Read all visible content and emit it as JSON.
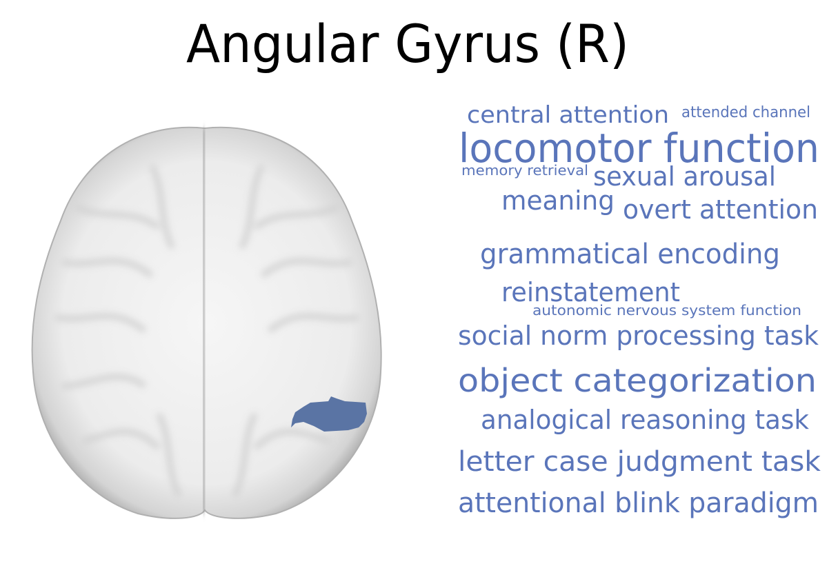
{
  "title": "Angular Gyrus (R)",
  "region_color": "#5a74a4",
  "word_color": "#5a75ba",
  "terms": [
    "central attention",
    "attended channel",
    "locomotor function",
    "memory retrieval",
    "sexual arousal",
    "meaning",
    "overt attention",
    "grammatical encoding",
    "reinstatement",
    "autonomic nervous system function",
    "social norm processing task",
    "object categorization",
    "analogical reasoning task",
    "letter case judgment task",
    "attentional blink paradigm"
  ]
}
